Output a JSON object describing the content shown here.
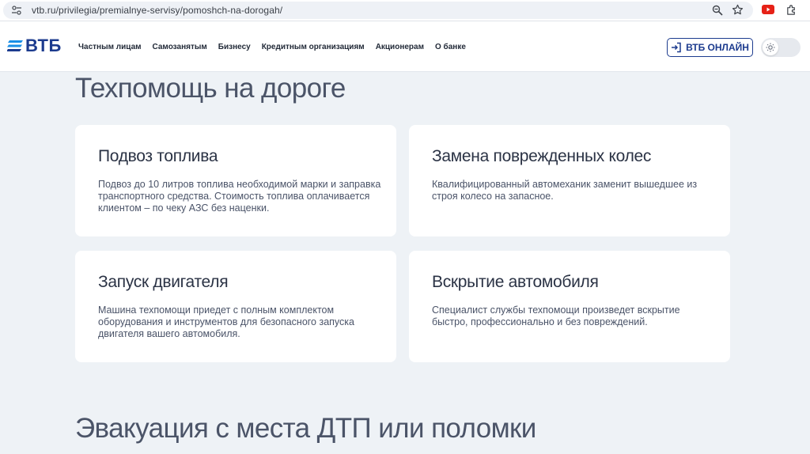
{
  "browser": {
    "url": "vtb.ru/privilegia/premialnye-servisy/pomoshch-na-dorogah/",
    "icons": [
      "site-info-icon",
      "zoom-icon",
      "star-icon",
      "youtube-icon",
      "extensions-icon"
    ],
    "accent_red": "#e62117"
  },
  "header": {
    "logo_text": "ВТБ",
    "brand_color": "#1c3b8e",
    "nav": [
      {
        "label": "Частным лицам"
      },
      {
        "label": "Самозанятым"
      },
      {
        "label": "Бизнесу"
      },
      {
        "label": "Кредитным организациям"
      },
      {
        "label": "Акционерам"
      },
      {
        "label": "О банке"
      }
    ],
    "online_button": "ВТБ ОНЛАЙН",
    "theme_toggle_icon": "sun-icon"
  },
  "main": {
    "section_title": "Техпомощь на дороге",
    "cards": [
      {
        "title": "Подвоз топлива",
        "text": "Подвоз до 10 литров топлива необходимой марки и заправка транспортного средства. Стоимость топлива оплачивается клиентом – по чеку АЗС без наценки."
      },
      {
        "title": "Замена поврежденных колес",
        "text": "Квалифицированный автомеханик заменит вышедшее из строя колесо на запасное."
      },
      {
        "title": "Запуск двигателя",
        "text": "Машина техпомощи приедет с полным комплектом оборудования и инструментов для безопасного запуска двигателя вашего автомобиля."
      },
      {
        "title": "Вскрытие автомобиля",
        "text": "Специалист службы техпомощи произведет вскрытие быстро, профессионально и без повреждений."
      }
    ],
    "next_section_title": "Эвакуация с места ДТП или поломки"
  }
}
